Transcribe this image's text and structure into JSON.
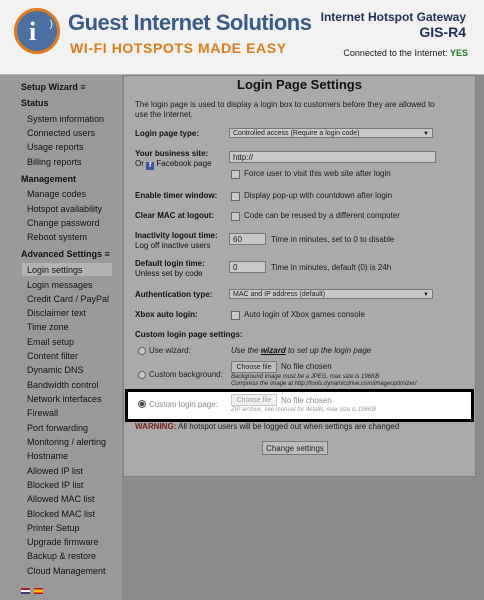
{
  "header": {
    "brand_name": "Guest Internet Solutions",
    "tagline": "WI-FI HOTSPOTS MADE EASY",
    "product": "Internet Hotspot Gateway",
    "model": "GIS-R4",
    "connection_label": "Connected to the Internet:",
    "connection_value": "YES",
    "logo_letter": "i"
  },
  "sidebar": {
    "setup_wizard": "Setup Wizard ≡",
    "status_head": "Status",
    "status_items": [
      "System information",
      "Connected users",
      "Usage reports",
      "Billing reports"
    ],
    "management_head": "Management",
    "management_items": [
      "Manage codes",
      "Hotspot availability",
      "Change password",
      "Reboot system"
    ],
    "advanced_head": "Advanced Settings ≡",
    "advanced_items": [
      "Login settings",
      "Login messages",
      "Credit Card / PayPal",
      "Disclaimer text",
      "Time zone",
      "Email setup",
      "Content filter",
      "Dynamic DNS",
      "Bandwidth control",
      "Network interfaces",
      "Firewall",
      "Port forwarding",
      "Monitoring / alerting",
      "Hostname",
      "Allowed IP list",
      "Blocked IP list",
      "Allowed MAC list",
      "Blocked MAC list",
      "Printer Setup",
      "Upgrade firmware",
      "Backup & restore",
      "Cloud Management"
    ],
    "active_item": "Login settings"
  },
  "main": {
    "title": "Login Page Settings",
    "intro_line1": "The login page is used to display a login box to customers before they are allowed to",
    "intro_line2": "use the Internet.",
    "login_page_type_label": "Login page type:",
    "login_page_type_value": "Controlled access (Require a login code)",
    "business_site_label": "Your business site:",
    "business_site_or": "Or",
    "facebook_label": "Facebook page",
    "business_site_value": "http://",
    "force_visit_label": "Force user to visit this web site after login",
    "timer_label": "Enable timer window:",
    "timer_desc": "Display pop-up with countdown after login",
    "clear_mac_label": "Clear MAC at logout:",
    "clear_mac_desc": "Code can be reused by a different computer",
    "inactivity_label": "Inactivity logout time:",
    "inactivity_sub": "Log off inactive users",
    "inactivity_value": "60",
    "inactivity_desc": "Time in minutes, set to 0 to disable",
    "default_login_label": "Default login time:",
    "default_login_sub": "Unless set by code",
    "default_login_value": "0",
    "default_login_desc": "Time in minutes, default (0) is 24h",
    "auth_label": "Authentication type:",
    "auth_value": "MAC and IP address (default)",
    "xbox_label": "Xbox auto login:",
    "xbox_desc": "Auto login of Xbox games console",
    "custom_settings_label": "Custom login page settings:",
    "use_wizard_label": "Use wizard:",
    "use_wizard_pre": "Use the",
    "use_wizard_link": "wizard",
    "use_wizard_post": "to set up the login page",
    "custom_bg_label": "Custom background:",
    "choose_file": "Choose file",
    "no_file": "No file chosen",
    "bg_note1": "Background image must be a JPEG, max size is 196KB",
    "bg_note2": "Compress the image at http://tools.dynamicdrive.com/imageoptimizer/",
    "custom_page_label": "Custom login page:",
    "page_note": "ZIP archive, see manual for details, max size is 196KB",
    "warning_label": "WARNING:",
    "warning_text": "All hotspot users will be logged out when settings are changed",
    "change_button": "Change settings"
  },
  "colors": {
    "brand_blue": "#3b5a88",
    "brand_orange": "#e07c1c",
    "connected_green": "#1f7a1f",
    "highlight_border": "#000000"
  }
}
